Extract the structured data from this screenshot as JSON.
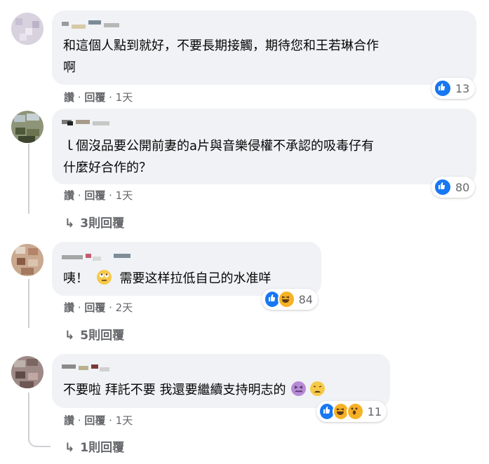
{
  "comments": [
    {
      "text_lines": [
        "和這個人點到就好，不要長期接觸，期待您和王若琳合作",
        "啊"
      ],
      "actions": {
        "like": "讚",
        "reply": "回覆",
        "time": "1天"
      },
      "reactions": {
        "count": "13"
      }
    },
    {
      "text_lines": [
        "ｌ個沒品要公開前妻的a片與音樂侵權不承認的吸毒仔有",
        "什麼好合作的？"
      ],
      "actions": {
        "like": "讚",
        "reply": "回覆",
        "time": "1天"
      },
      "reactions": {
        "count": "80"
      },
      "replies_label": "3則回覆"
    },
    {
      "text_parts": {
        "before": "咦！",
        "after": "需要这样拉低自己的水准咩"
      },
      "emoji_icon": "rolling-eyes-emoji-icon",
      "actions": {
        "like": "讚",
        "reply": "回覆",
        "time": "2天"
      },
      "reactions": {
        "count": "84"
      },
      "replies_label": "5則回覆"
    },
    {
      "text": "不要啦 拜託不要 我還要繼續支持明志的",
      "emoji_icons": [
        "confounded-emoji-icon",
        "weary-emoji-icon"
      ],
      "actions": {
        "like": "讚",
        "reply": "回覆",
        "time": "1天"
      },
      "reactions": {
        "count": "11"
      },
      "replies_label": "1則回覆"
    }
  ],
  "colors": {
    "like": "#1877f2",
    "bubble": "#f0f2f5",
    "meta": "#65676b",
    "text": "#050505"
  },
  "icons": [
    "like-icon",
    "haha-icon",
    "wow-icon",
    "reply-arrow-icon"
  ]
}
